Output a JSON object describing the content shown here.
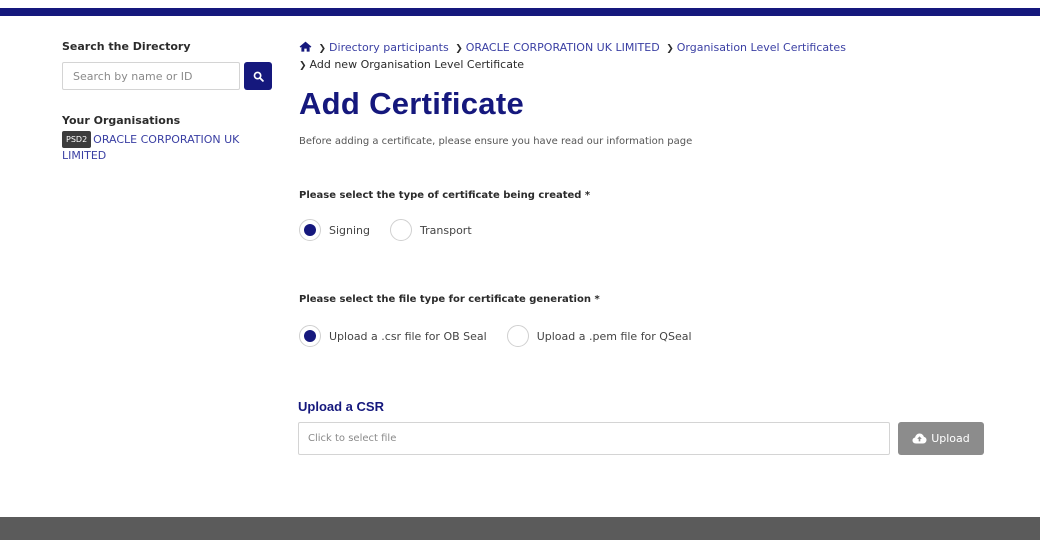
{
  "sidebar": {
    "search_title": "Search the Directory",
    "search_placeholder": "Search by name or ID",
    "orgs_title": "Your Organisations",
    "org_badge": "PSD2",
    "org_name": "ORACLE CORPORATION UK LIMITED"
  },
  "breadcrumb": {
    "items": [
      "Directory participants",
      "ORACLE CORPORATION UK LIMITED",
      "Organisation Level Certificates"
    ],
    "current": "Add new Organisation Level Certificate"
  },
  "page": {
    "title": "Add Certificate",
    "intro": "Before adding a certificate, please ensure you have read our information page"
  },
  "cert_type": {
    "label": "Please select the type of certificate being created *",
    "options": [
      "Signing",
      "Transport"
    ],
    "selected": "Signing"
  },
  "file_type": {
    "label": "Please select the file type for certificate generation *",
    "options": [
      "Upload a .csr file for OB Seal",
      "Upload a .pem file for QSeal"
    ],
    "selected": "Upload a .csr file for OB Seal"
  },
  "upload": {
    "title": "Upload a CSR",
    "placeholder": "Click to select file",
    "button_label": "Upload"
  },
  "colors": {
    "brand": "#15187d",
    "link": "#3a3fa3",
    "footer": "#5b5b5b",
    "upload_button": "#8c8c8c"
  }
}
